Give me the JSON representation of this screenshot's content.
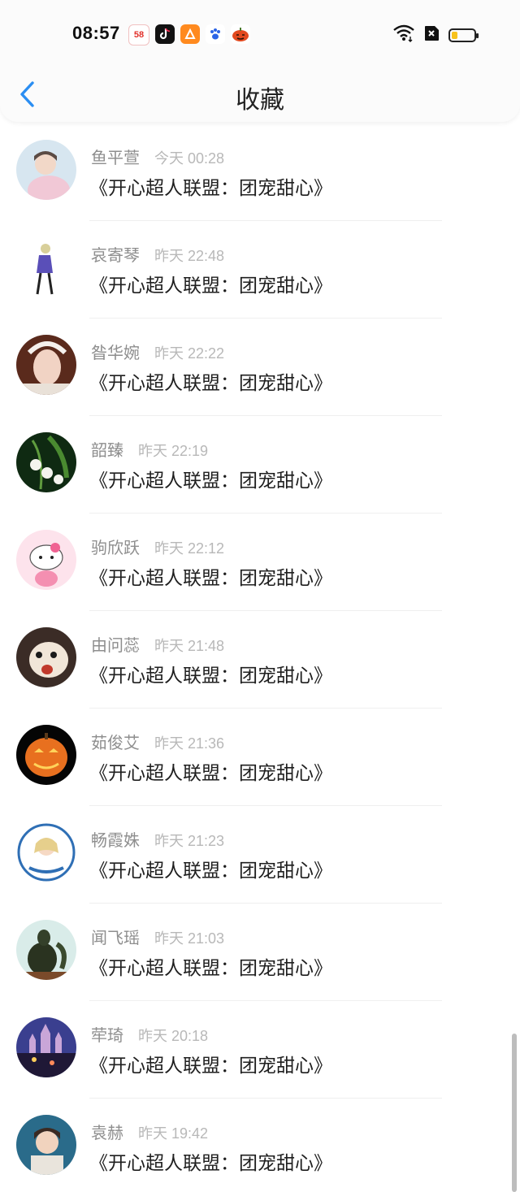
{
  "status_bar": {
    "time": "08:57",
    "app_icons": [
      "58-tongcheng-icon",
      "douyin-icon",
      "orange-app-icon",
      "baidu-paw-icon",
      "pumpkin-icon"
    ],
    "icon_58_text": "58",
    "wifi_icon": "wifi-icon",
    "no_sim_icon": "no-sim-icon",
    "battery_level": 0.25
  },
  "header": {
    "title": "收藏",
    "back_icon": "chevron-left-icon",
    "accent_color": "#2b8ef2"
  },
  "favorites": [
    {
      "name": "鱼平萱",
      "time": "今天 00:28",
      "book": "《开心超人联盟：团宠甜心》"
    },
    {
      "name": "哀寄琴",
      "time": "昨天 22:48",
      "book": "《开心超人联盟：团宠甜心》"
    },
    {
      "name": "昝华婉",
      "time": "昨天 22:22",
      "book": "《开心超人联盟：团宠甜心》"
    },
    {
      "name": "韶臻",
      "time": "昨天 22:19",
      "book": "《开心超人联盟：团宠甜心》"
    },
    {
      "name": "驹欣跃",
      "time": "昨天 22:12",
      "book": "《开心超人联盟：团宠甜心》"
    },
    {
      "name": "由问蕊",
      "time": "昨天 21:48",
      "book": "《开心超人联盟：团宠甜心》"
    },
    {
      "name": "茹俊艾",
      "time": "昨天 21:36",
      "book": "《开心超人联盟：团宠甜心》"
    },
    {
      "name": "畅霞姝",
      "time": "昨天 21:23",
      "book": "《开心超人联盟：团宠甜心》"
    },
    {
      "name": "闻飞瑶",
      "time": "昨天 21:03",
      "book": "《开心超人联盟：团宠甜心》"
    },
    {
      "name": "荦琦",
      "time": "昨天 20:18",
      "book": "《开心超人联盟：团宠甜心》"
    },
    {
      "name": "袁赫",
      "time": "昨天 19:42",
      "book": "《开心超人联盟：团宠甜心》"
    }
  ]
}
